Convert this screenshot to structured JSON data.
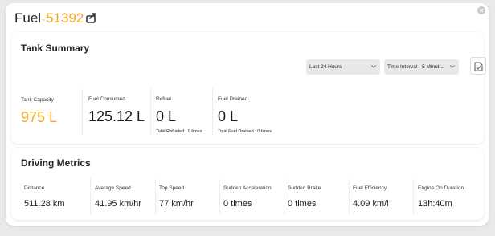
{
  "header": {
    "title": "Fuel",
    "separator": "-",
    "vehicle_id": "51392",
    "accent_color": "#f5a623"
  },
  "tank_summary": {
    "title": "Tank Summary",
    "period_select": "Last 24 Hours",
    "interval_select": "Time Interval - 5 Minut...",
    "stats": [
      {
        "label": "Tank Capacity",
        "value": "975 L"
      },
      {
        "label": "Fuel Consumed",
        "value": "125.12 L"
      },
      {
        "label": "Refuel",
        "value": "0 L",
        "sub": "Total Refueled : 0 times"
      },
      {
        "label": "Fuel Drained",
        "value": "0 L",
        "sub": "Total Fuel Drained : 0 times"
      }
    ]
  },
  "driving_metrics": {
    "title": "Driving Metrics",
    "metrics": [
      {
        "label": "Distance",
        "value": "511.28 km"
      },
      {
        "label": "Average Speed",
        "value": "41.95 km/hr"
      },
      {
        "label": "Top Speed",
        "value": "77 km/hr"
      },
      {
        "label": "Sudden Acceleration",
        "value": "0 times"
      },
      {
        "label": "Sudden Brake",
        "value": "0 times"
      },
      {
        "label": "Fuel Efficiency",
        "value": "4.09 km/l"
      },
      {
        "label": "Engine On Duration",
        "value": "13h:40m"
      }
    ]
  }
}
